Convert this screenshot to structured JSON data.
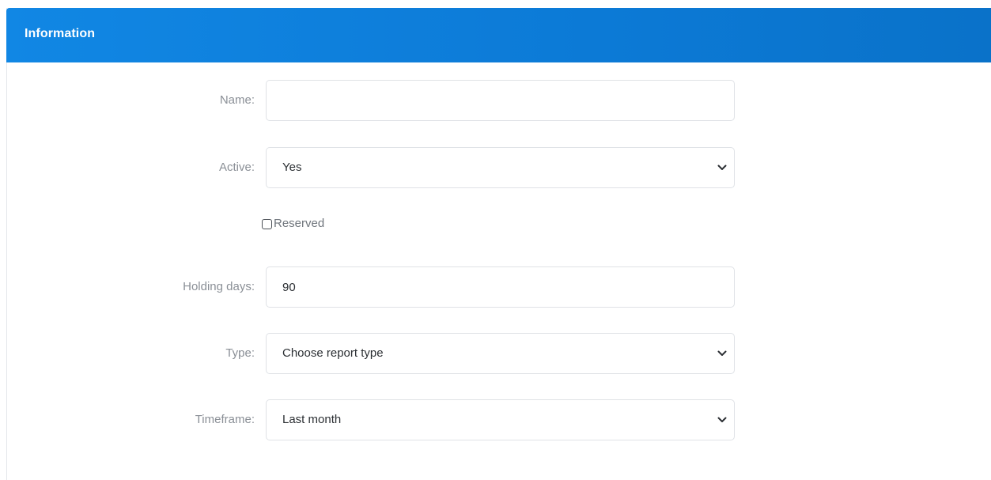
{
  "panel": {
    "title": "Information"
  },
  "form": {
    "name": {
      "label": "Name:",
      "value": "",
      "placeholder": ""
    },
    "active": {
      "label": "Active:",
      "selected": "Yes",
      "icon": "chevron-down-icon"
    },
    "reserved": {
      "label": "Reserved",
      "checked": false
    },
    "holding_days": {
      "label": "Holding days:",
      "value": "90"
    },
    "type": {
      "label": "Type:",
      "selected": "Choose report type",
      "icon": "chevron-down-icon"
    },
    "timeframe": {
      "label": "Timeframe:",
      "selected": "Last month",
      "icon": "chevron-down-icon"
    }
  },
  "colors": {
    "header": "#0c7ad6",
    "label_text": "#8a8f96",
    "field_border": "#dfe2e6"
  }
}
